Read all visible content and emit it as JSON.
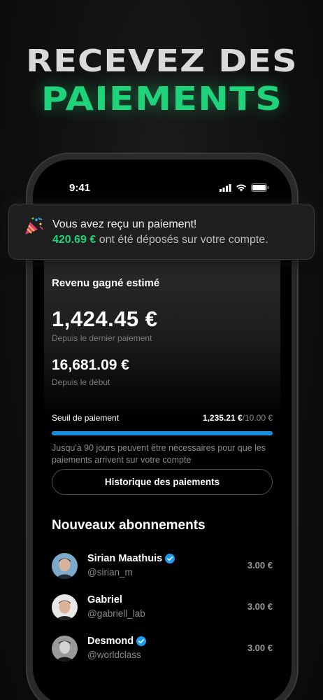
{
  "hero": {
    "line1": "RECEVEZ DES",
    "line2": "PAIEMENTS"
  },
  "status": {
    "time": "9:41"
  },
  "notification": {
    "title": "Vous avez reçu un paiement!",
    "amount": "420.69 €",
    "message": "ont été déposés sur votre compte.",
    "icon": "party-popper-icon"
  },
  "revenue": {
    "title": "Revenu gagné estimé",
    "since_last_amount": "1,424.45 €",
    "since_last_label": "Depuis le dernier paiement",
    "since_start_amount": "16,681.09 €",
    "since_start_label": "Depuis le début"
  },
  "threshold": {
    "label": "Seuil de paiement",
    "current": "1,235.21 €",
    "target": "/10.00 €",
    "progress_fraction": 1.0,
    "note": "Jusqu'à 90 jours peuvent être nécessaires pour que les paiements arrivent sur votre compte"
  },
  "history_button": "Historique des paiements",
  "subscriptions": {
    "title": "Nouveaux abonnements",
    "items": [
      {
        "name": "Sirian Maathuis",
        "handle": "@sirian_m",
        "price": "3.00 €",
        "verified": true
      },
      {
        "name": "Gabriel",
        "handle": "@gabriell_lab",
        "price": "3.00 €",
        "verified": false
      },
      {
        "name": "Desmond",
        "handle": "@worldclass",
        "price": "3.00 €",
        "verified": true
      }
    ]
  },
  "colors": {
    "accent_green": "#1fd37a",
    "progress_blue": "#1d8fe0",
    "verified_blue": "#1d9bf0"
  }
}
